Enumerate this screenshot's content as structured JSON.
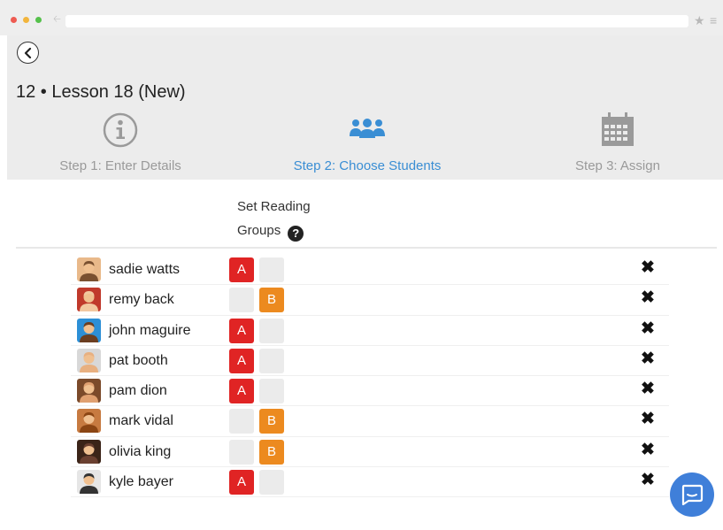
{
  "header": {
    "title": "12 • Lesson 18 (New)"
  },
  "steps": [
    {
      "label": "Step 1: Enter Details",
      "icon": "info-icon",
      "state": "inactive"
    },
    {
      "label": "Step 2: Choose Students",
      "icon": "group-icon",
      "state": "active"
    },
    {
      "label": "Step 3: Assign",
      "icon": "calendar-icon",
      "state": "inactive"
    }
  ],
  "groups_heading": {
    "line1": "Set Reading",
    "line2": "Groups"
  },
  "students": [
    {
      "name": "sadie watts",
      "group": "A"
    },
    {
      "name": "remy back",
      "group": "B"
    },
    {
      "name": "john maguire",
      "group": "A"
    },
    {
      "name": "pat booth",
      "group": "A"
    },
    {
      "name": "pam dion",
      "group": "A"
    },
    {
      "name": "mark vidal",
      "group": "B"
    },
    {
      "name": "olivia king",
      "group": "B"
    },
    {
      "name": "kyle bayer",
      "group": "A"
    }
  ],
  "group_labels": {
    "a": "A",
    "b": "B"
  },
  "colors": {
    "group_a": "#e02424",
    "group_b": "#ec8a1f",
    "active_step": "#3a8ed4",
    "inactive_step": "#9a9a9a",
    "chat": "#3f7fd9"
  }
}
